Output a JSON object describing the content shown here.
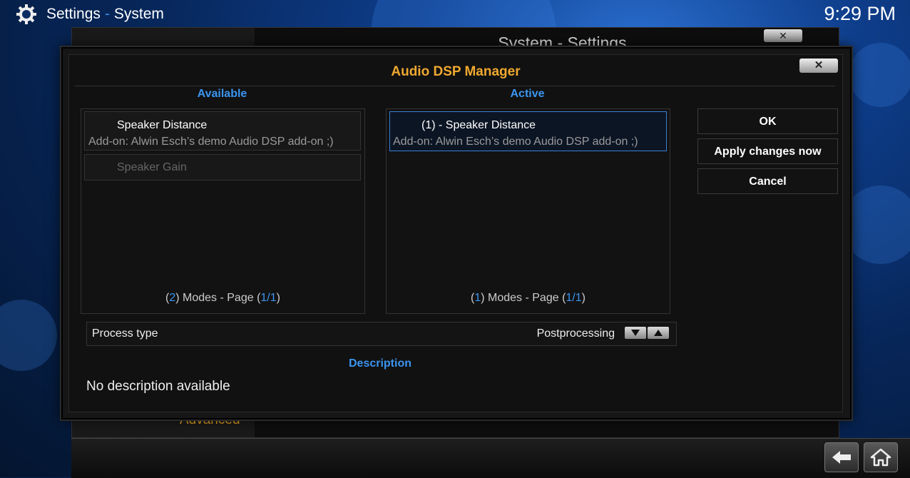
{
  "header": {
    "section": "Settings",
    "separator": "-",
    "subsection": "System",
    "clock": "9:29 PM"
  },
  "background_window": {
    "title": "System - Settings",
    "close_label": "✕",
    "menu_item_advanced": "Advanced"
  },
  "dialog": {
    "title": "Audio DSP Manager",
    "close_label": "✕",
    "available": {
      "heading": "Available",
      "items": [
        {
          "name": "Speaker Distance",
          "addon": "Add-on: Alwin Esch’s demo Audio DSP add-on ;)"
        },
        {
          "name": "Speaker Gain"
        }
      ],
      "pager": {
        "count": "2",
        "modes_text": ") Modes - Page (",
        "page": "1",
        "slash": "/",
        "pages": "1",
        "close": ")",
        "open": "("
      }
    },
    "active": {
      "heading": "Active",
      "items": [
        {
          "name": "(1) - Speaker Distance",
          "addon": "Add-on: Alwin Esch’s demo Audio DSP add-on ;)"
        }
      ],
      "pager": {
        "count": "1",
        "modes_text": ") Modes - Page (",
        "page": "1",
        "slash": "/",
        "pages": "1",
        "close": ")",
        "open": "("
      }
    },
    "process_type": {
      "label": "Process type",
      "value": "Postprocessing"
    },
    "description": {
      "heading": "Description",
      "text": "No description available"
    },
    "buttons": {
      "ok": "OK",
      "apply": "Apply changes now",
      "cancel": "Cancel"
    }
  },
  "icons": [
    "gear-icon",
    "close-icon",
    "down-arrow-icon",
    "up-arrow-icon",
    "back-arrow-icon",
    "home-icon"
  ],
  "colors": {
    "accent_blue": "#3a95f0",
    "title_orange": "#f0a830"
  }
}
